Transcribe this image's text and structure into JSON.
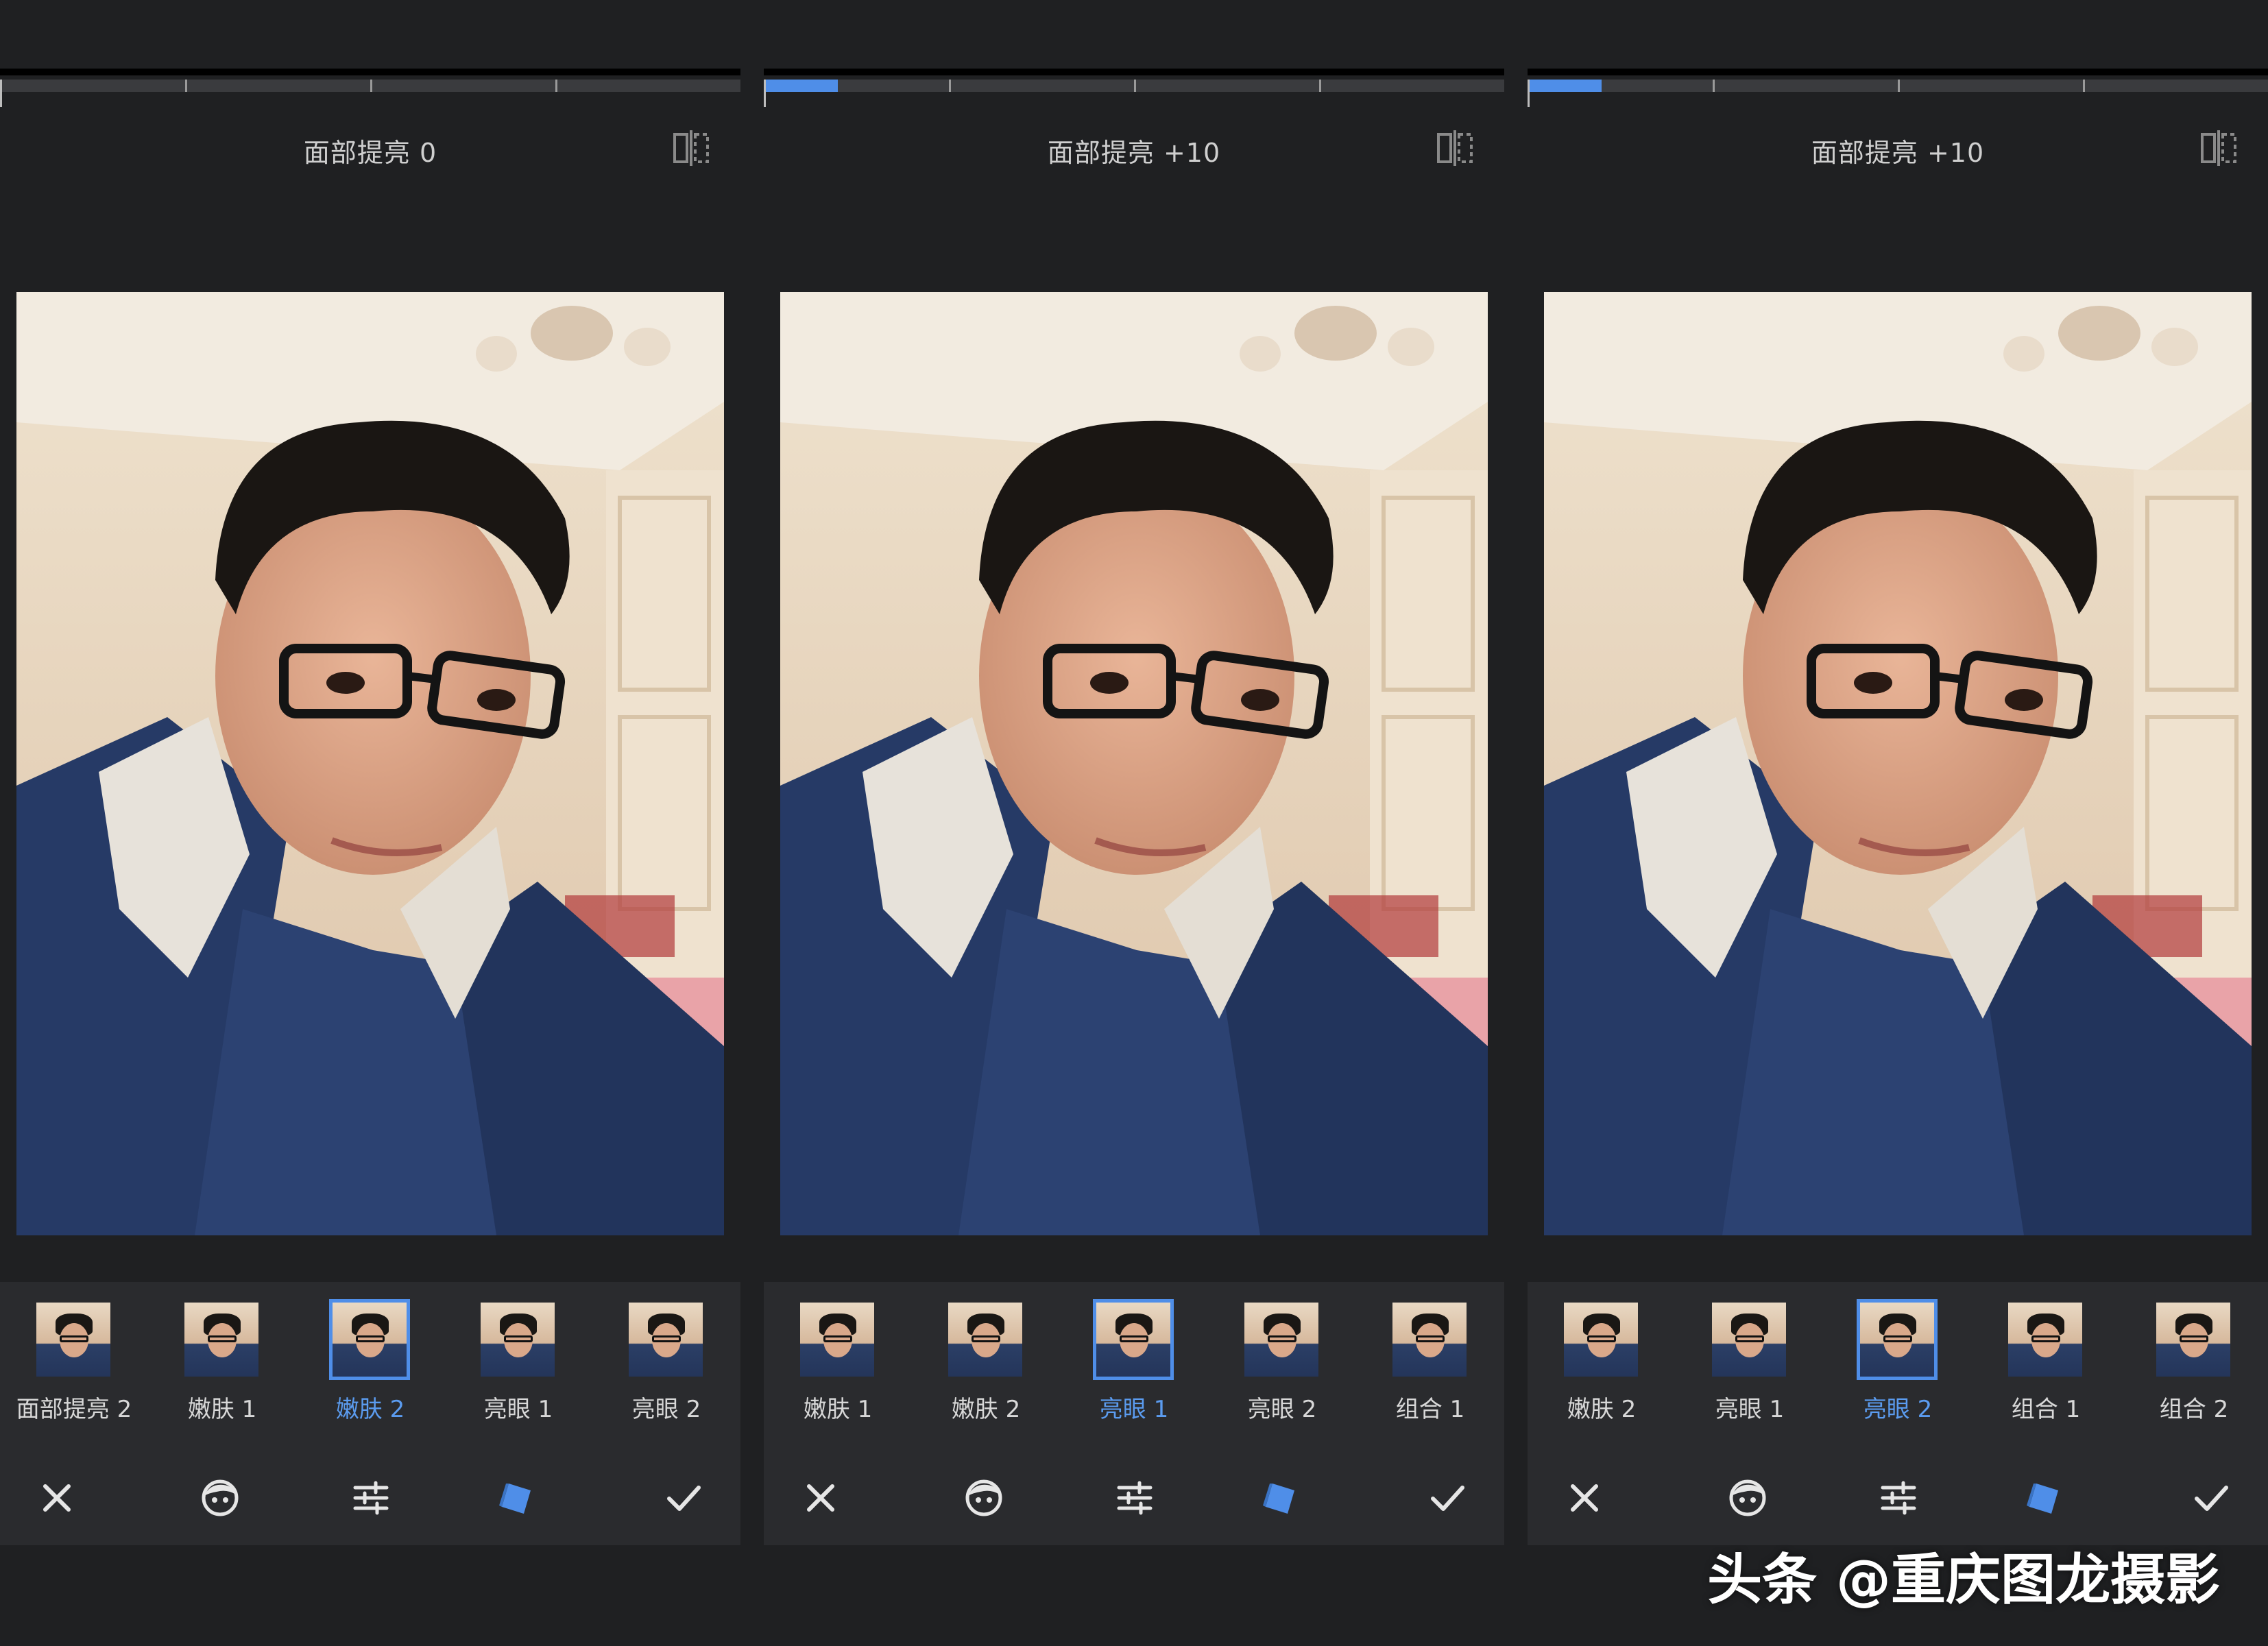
{
  "panels": [
    {
      "value_label": "面部提亮 0",
      "slider_fraction": 0.0,
      "presets": [
        {
          "label": "面部提亮 2",
          "selected": false
        },
        {
          "label": "嫩肤 1",
          "selected": false
        },
        {
          "label": "嫩肤 2",
          "selected": true
        },
        {
          "label": "亮眼 1",
          "selected": false
        },
        {
          "label": "亮眼 2",
          "selected": false
        }
      ]
    },
    {
      "value_label": "面部提亮 +10",
      "slider_fraction": 0.1,
      "presets": [
        {
          "label": "嫩肤 1",
          "selected": false
        },
        {
          "label": "嫩肤 2",
          "selected": false
        },
        {
          "label": "亮眼 1",
          "selected": true
        },
        {
          "label": "亮眼 2",
          "selected": false
        },
        {
          "label": "组合 1",
          "selected": false
        }
      ]
    },
    {
      "value_label": "面部提亮 +10",
      "slider_fraction": 0.1,
      "presets": [
        {
          "label": "嫩肤 2",
          "selected": false
        },
        {
          "label": "亮眼 1",
          "selected": false
        },
        {
          "label": "亮眼 2",
          "selected": true
        },
        {
          "label": "组合 1",
          "selected": false
        },
        {
          "label": "组合 2",
          "selected": false
        }
      ]
    }
  ],
  "toolbar_icons": [
    "close-icon",
    "face-icon",
    "adjust-icon",
    "styles-icon",
    "check-icon"
  ],
  "colors": {
    "accent": "#4f8ee8",
    "background": "#1f2022",
    "strip": "#2a2b2e"
  },
  "watermark": "头条 @重庆图龙摄影"
}
